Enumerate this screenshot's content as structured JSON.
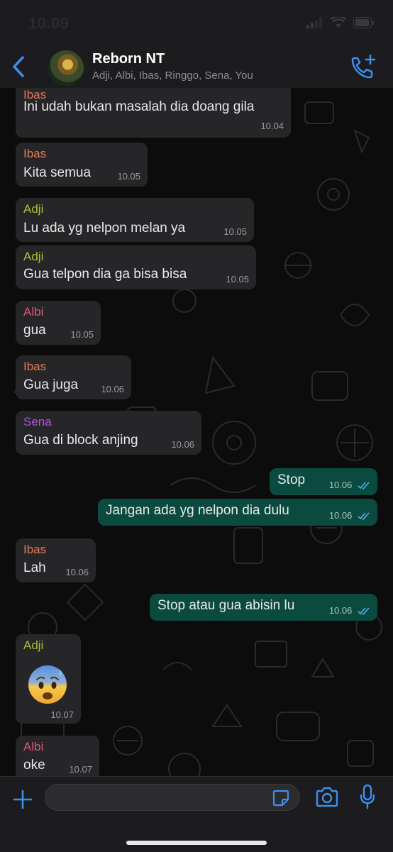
{
  "status_bar": {
    "time": "10.09"
  },
  "header": {
    "title": "Reborn NT",
    "members": "Adji, Albi, Ibas, Ringgo, Sena, You"
  },
  "colors": {
    "adji": "#a7c23a",
    "ibas": "#e07a55",
    "albi": "#e0577a",
    "sena": "#b155e0",
    "tick": "#4fb0f5",
    "accent": "#3d8ff0"
  },
  "messages": [
    {
      "sender": "Ibas",
      "text": "Ini udah bukan masalah dia doang gila",
      "time": "10.04"
    },
    {
      "sender": "Ibas",
      "text": "Kita semua",
      "time": "10.05"
    },
    {
      "sender": "Adji",
      "text": "Lu ada yg nelpon melan ya",
      "time": "10.05"
    },
    {
      "sender": "Adji",
      "text": "Gua telpon dia ga bisa bisa",
      "time": "10.05"
    },
    {
      "sender": "Albi",
      "text": "gua",
      "time": "10.05"
    },
    {
      "sender": "Ibas",
      "text": "Gua juga",
      "time": "10.06"
    },
    {
      "sender": "Sena",
      "text": "Gua di block anjing",
      "time": "10.06"
    },
    {
      "sender": "You",
      "text": "Stop",
      "time": "10.06"
    },
    {
      "sender": "You",
      "text": "Jangan ada yg nelpon dia dulu",
      "time": "10.06"
    },
    {
      "sender": "Ibas",
      "text": "Lah",
      "time": "10.06"
    },
    {
      "sender": "You",
      "text": "Stop atau gua abisin lu",
      "time": "10.06"
    },
    {
      "sender": "Adji",
      "text": "",
      "emoji": "anxious-face-with-sweat",
      "time": "10.07"
    },
    {
      "sender": "Albi",
      "text": "oke",
      "time": "10.07"
    }
  ],
  "input": {
    "placeholder": ""
  },
  "icons": {
    "back": "chevron-left-icon",
    "call": "add-call-icon",
    "plus": "plus-icon",
    "sticker": "sticker-icon",
    "camera": "camera-icon",
    "mic": "microphone-icon"
  }
}
